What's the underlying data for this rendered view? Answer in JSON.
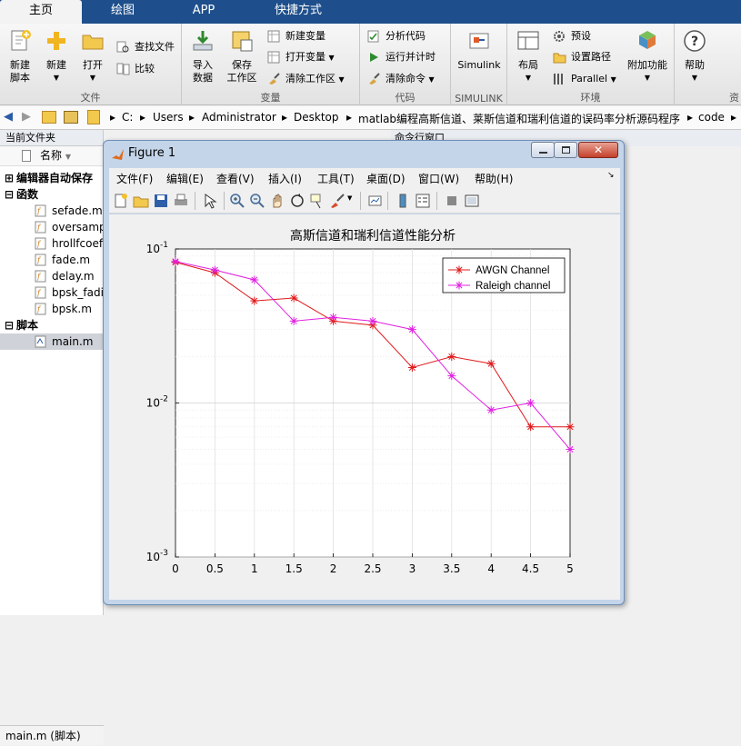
{
  "tabs": [
    {
      "label": "主页",
      "active": true
    },
    {
      "label": "绘图"
    },
    {
      "label": "APP"
    },
    {
      "label": "快捷方式"
    }
  ],
  "ribbon": {
    "file": {
      "group": "文件",
      "new_script": "新建\n脚本",
      "new": "新建",
      "open": "打开",
      "find_files": "查找文件",
      "compare": "比较"
    },
    "variable": {
      "group": "变量",
      "import": "导入\n数据",
      "save_ws": "保存\n工作区",
      "new_var": "新建变量",
      "open_var": "打开变量",
      "clear_ws": "清除工作区"
    },
    "code": {
      "group": "代码",
      "analyze": "分析代码",
      "run_time": "运行并计时",
      "clear_cmd": "清除命令"
    },
    "simulink": {
      "group": "SIMULINK",
      "simulink": "Simulink"
    },
    "env": {
      "group": "环境",
      "layout": "布局",
      "prefs": "预设",
      "set_path": "设置路径",
      "parallel": "Parallel",
      "addons": "附加功能"
    },
    "resources": {
      "help": "帮助",
      "group": "资"
    }
  },
  "address": {
    "segments": [
      "C:",
      "Users",
      "Administrator",
      "Desktop",
      "matlab编程高斯信道、莱斯信道和瑞利信道的误码率分析源码程序",
      "code"
    ]
  },
  "current_folder": {
    "title": "当前文件夹",
    "col_name": "名称",
    "sections": [
      {
        "label": "编辑器自动保存"
      },
      {
        "label": "函数",
        "files": [
          "sefade.m",
          "oversamp",
          "hrollfcoef",
          "fade.m",
          "delay.m",
          "bpsk_fadi",
          "bpsk.m"
        ]
      },
      {
        "label": "脚本",
        "files": [
          "main.m"
        ]
      }
    ],
    "status": "main.m  (脚本)"
  },
  "command_window": {
    "title": "命令行窗口"
  },
  "figure": {
    "title": "Figure 1",
    "menus": [
      "文件(F)",
      "编辑(E)",
      "查看(V)",
      "插入(I)",
      "工具(T)",
      "桌面(D)",
      "窗口(W)",
      "帮助(H)"
    ]
  },
  "chart_data": {
    "type": "line",
    "title": "高斯信道和瑞利信道性能分析",
    "xlabel": "",
    "ylabel": "",
    "x": [
      0,
      0.5,
      1,
      1.5,
      2,
      2.5,
      3,
      3.5,
      4,
      4.5,
      5
    ],
    "xlim": [
      0,
      5
    ],
    "ylim": [
      0.001,
      0.1
    ],
    "yscale": "log",
    "x_ticks": [
      "0",
      "0.5",
      "1",
      "1.5",
      "2",
      "2.5",
      "3",
      "3.5",
      "4",
      "4.5",
      "5"
    ],
    "y_ticks": [
      {
        "base": "10",
        "exp": "-1"
      },
      {
        "base": "10",
        "exp": "-2"
      },
      {
        "base": "10",
        "exp": "-3"
      }
    ],
    "grid": true,
    "legend_position": "top-right",
    "series": [
      {
        "name": "AWGN Channel",
        "color": "#e0191b",
        "marker": "*",
        "values": [
          0.082,
          0.07,
          0.046,
          0.048,
          0.034,
          0.032,
          0.017,
          0.02,
          0.018,
          0.007,
          0.007
        ]
      },
      {
        "name": "Raleigh channel",
        "color": "#e020e0",
        "marker": "*",
        "values": [
          0.083,
          0.073,
          0.063,
          0.034,
          0.036,
          0.034,
          0.03,
          0.015,
          0.009,
          0.01,
          0.005
        ]
      }
    ]
  }
}
